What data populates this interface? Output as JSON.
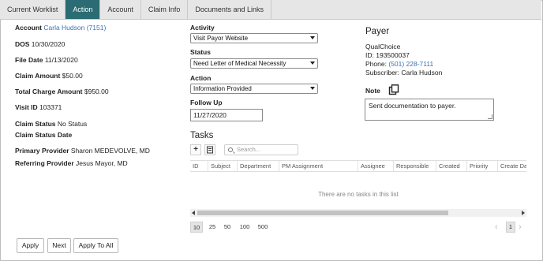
{
  "tabs": [
    "Current Worklist",
    "Action",
    "Account",
    "Claim Info",
    "Documents and Links"
  ],
  "account": {
    "account_label": "Account",
    "account_value": "Carla Hudson (7151)",
    "dos_label": "DOS",
    "dos_value": "10/30/2020",
    "file_date_label": "File Date",
    "file_date_value": "11/13/2020",
    "claim_amount_label": "Claim Amount",
    "claim_amount_value": "$50.00",
    "total_charge_label": "Total Charge Amount",
    "total_charge_value": "$950.00",
    "visit_id_label": "Visit ID",
    "visit_id_value": "103371",
    "claim_status_label": "Claim Status",
    "claim_status_value": "No Status",
    "claim_status_date_label": "Claim Status Date",
    "primary_provider_label": "Primary Provider",
    "primary_provider_value": "Sharon MEDEVOLVE, MD",
    "referring_provider_label": "Referring Provider",
    "referring_provider_value": "Jesus Mayor, MD"
  },
  "form": {
    "activity_label": "Activity",
    "activity_value": "Visit Payor Website",
    "status_label": "Status",
    "status_value": "Need Letter of Medical Necessity",
    "action_label": "Action",
    "action_value": "Information Provided",
    "follow_up_label": "Follow Up",
    "follow_up_value": "11/27/2020"
  },
  "payer": {
    "title": "Payer",
    "name": "QualChoice",
    "id_label": "ID:",
    "id_value": "193500037",
    "phone_label": "Phone:",
    "phone_value": "(501) 228-7111",
    "subscriber_label": "Subscriber:",
    "subscriber_value": "Carla Hudson"
  },
  "note": {
    "label": "Note",
    "text": "Sent documentation to payer."
  },
  "tasks": {
    "title": "Tasks",
    "add_symbol": "+",
    "search_placeholder": "Search...",
    "columns": [
      "ID",
      "Subject",
      "Department",
      "PM Assignment",
      "Assignee",
      "Responsible",
      "Created",
      "Priority",
      "Create Date"
    ],
    "empty_message": "There are no tasks in this list",
    "page_sizes": [
      "10",
      "25",
      "50",
      "100",
      "500"
    ],
    "current_page": "1",
    "prev_symbol": "‹",
    "next_symbol": "›"
  },
  "buttons": {
    "apply": "Apply",
    "next": "Next",
    "apply_to_all": "Apply To All"
  },
  "colors": {
    "active_tab": "#2b6b73",
    "link": "#3a72b4"
  }
}
